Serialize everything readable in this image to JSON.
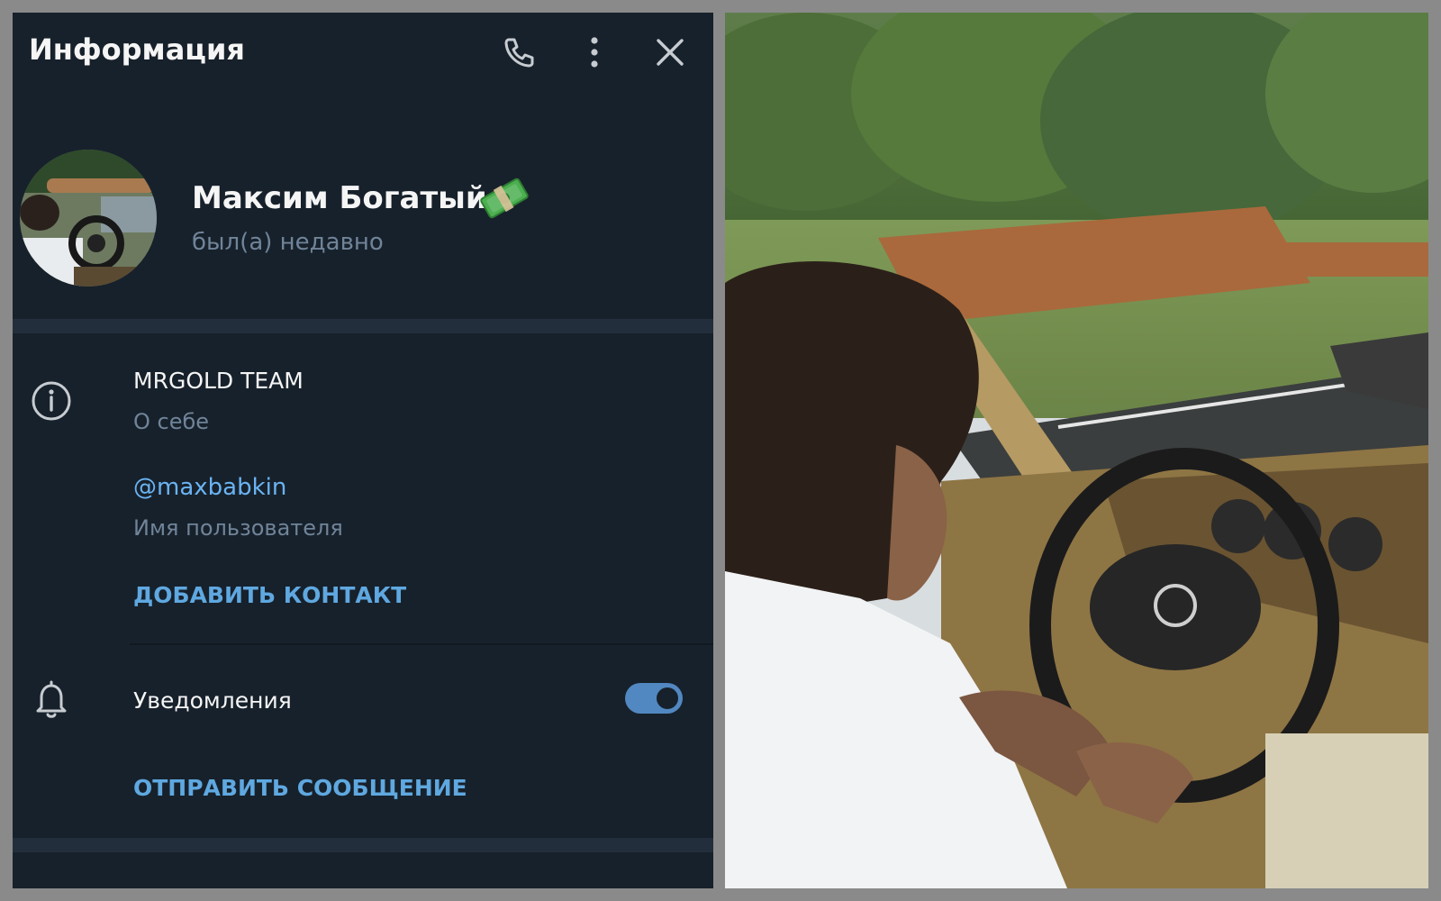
{
  "header": {
    "title": "Информация",
    "icons": [
      "phone-icon",
      "more-vertical-icon",
      "close-icon"
    ]
  },
  "profile": {
    "name": "Максим Богатый",
    "status": "был(а) недавно",
    "name_emoji_icon": "money-bill-emoji-icon"
  },
  "info": {
    "bio_value": "MRGOLD TEAM",
    "bio_label": "О себе",
    "username_value": "@maxbabkin",
    "username_label": "Имя пользователя",
    "add_contact_label": "ДОБАВИТЬ КОНТАКТ"
  },
  "notifications": {
    "label": "Уведомления",
    "enabled": true,
    "send_message_label": "ОТПРАВИТЬ СООБЩЕНИЕ"
  },
  "colors": {
    "panel_bg": "#17212b",
    "accent": "#5288c1",
    "link": "#6ab3f3",
    "secondary_text": "#708499"
  }
}
